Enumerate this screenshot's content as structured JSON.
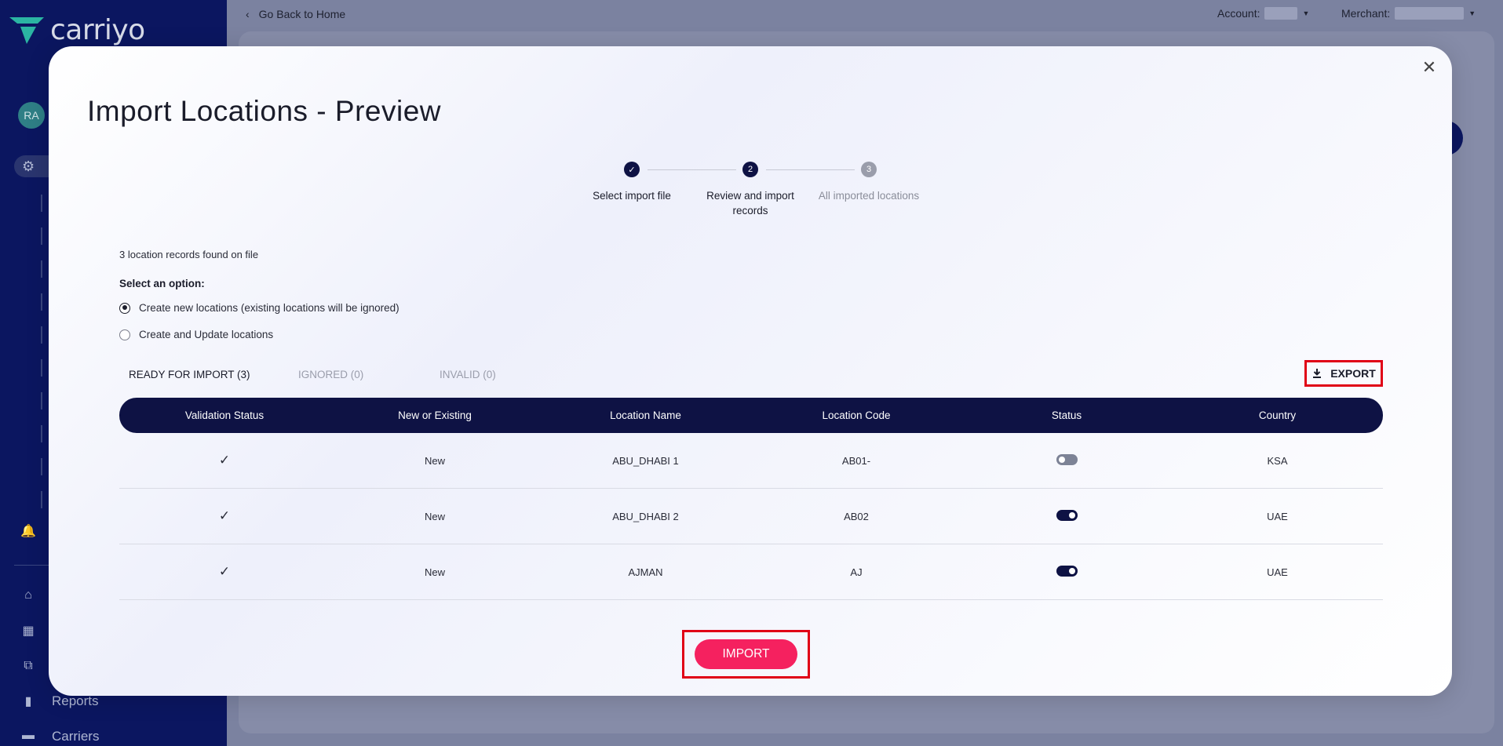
{
  "app": {
    "brand": "carriyo",
    "user_initials": "RA"
  },
  "topbar": {
    "back_link": "Go Back to Home",
    "account_label": "Account:",
    "merchant_label": "Merchant:"
  },
  "sidebar": {
    "reports_label": "Reports",
    "carriers_label": "Carriers"
  },
  "modal": {
    "title": "Import Locations - Preview",
    "steps": [
      {
        "label": "Select import file",
        "state": "done",
        "number": ""
      },
      {
        "label": "Review and import records",
        "state": "current",
        "number": "2"
      },
      {
        "label": "All imported locations",
        "state": "upcoming",
        "number": "3"
      }
    ],
    "records_found": "3 location records found on file",
    "select_option_title": "Select an option:",
    "options": [
      {
        "label": "Create new locations (existing locations will be ignored)",
        "selected": true
      },
      {
        "label": "Create and Update locations",
        "selected": false
      }
    ],
    "tabs": [
      {
        "label": "READY FOR IMPORT (3)",
        "active": true
      },
      {
        "label": "IGNORED (0)",
        "active": false
      },
      {
        "label": "INVALID (0)",
        "active": false
      }
    ],
    "export_label": "EXPORT",
    "table": {
      "columns": [
        "Validation Status",
        "New or Existing",
        "Location Name",
        "Location Code",
        "Status",
        "Country"
      ],
      "rows": [
        {
          "validation": "✓",
          "new_or_existing": "New",
          "location_name": "ABU_DHABI 1",
          "location_code": "AB01-",
          "status_on": false,
          "country": "KSA"
        },
        {
          "validation": "✓",
          "new_or_existing": "New",
          "location_name": "ABU_DHABI 2",
          "location_code": "AB02",
          "status_on": true,
          "country": "UAE"
        },
        {
          "validation": "✓",
          "new_or_existing": "New",
          "location_name": "AJMAN",
          "location_code": "AJ",
          "status_on": true,
          "country": "UAE"
        }
      ]
    },
    "import_label": "IMPORT"
  },
  "colors": {
    "sidebar": "#0b1660",
    "primary_dark": "#0e1244",
    "import_pink": "#f5215f",
    "highlight_red": "#e00016",
    "logo_teal": "#2bb5a3"
  }
}
